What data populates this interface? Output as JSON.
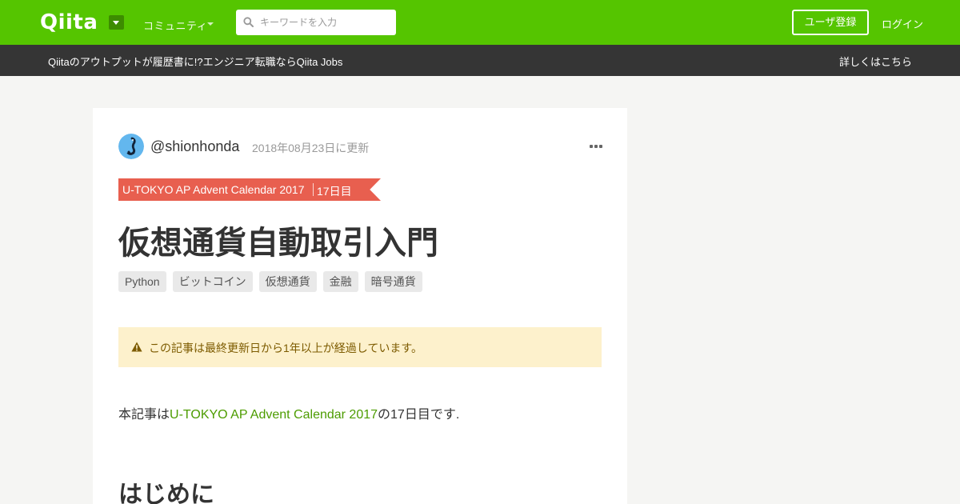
{
  "header": {
    "logo": "Qiita",
    "community_label": "コミュニティ",
    "search_placeholder": "キーワードを入力",
    "signup_label": "ユーザ登録",
    "login_label": "ログイン",
    "bg_color": "#55c500"
  },
  "banner": {
    "text": "Qiitaのアウトプットが履歴書に!?エンジニア転職ならQiita Jobs",
    "link": "詳しくはこちら"
  },
  "article": {
    "author": "@shionhonda",
    "updated": "2018年08月23日に更新",
    "advent": {
      "name": "U-TOKYO AP Advent Calendar 2017",
      "day": "17日目",
      "color": "#e85f4f"
    },
    "title": "仮想通貨自動取引入門",
    "tags": [
      "Python",
      "ビットコイン",
      "仮想通貨",
      "金融",
      "暗号通貨"
    ],
    "notice": "この記事は最終更新日から1年以上が経過しています。",
    "body": {
      "prefix": "本記事は",
      "link": "U-TOKYO AP Advent Calendar 2017",
      "suffix": "の17日目です."
    },
    "section_heading": "はじめに"
  }
}
